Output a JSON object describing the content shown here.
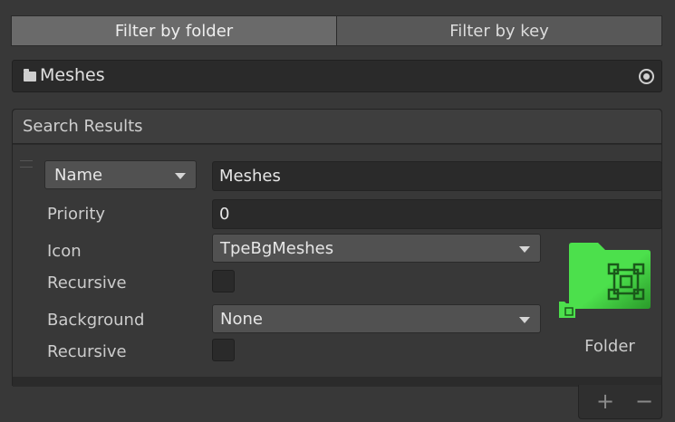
{
  "tabs": [
    {
      "label": "Filter by folder",
      "active": true
    },
    {
      "label": "Filter by key",
      "active": false
    }
  ],
  "folder_field": {
    "icon": "folder-icon",
    "value": "Meshes",
    "picker_icon": "target-icon"
  },
  "results": {
    "title": "Search Results",
    "rule": {
      "filter_type": "Name",
      "filter_value": "Meshes",
      "priority_label": "Priority",
      "priority_value": "0",
      "icon_label": "Icon",
      "icon_value": "TpeBgMeshes",
      "icon_recursive_label": "Recursive",
      "icon_recursive": false,
      "background_label": "Background",
      "background_value": "None",
      "background_recursive_label": "Recursive",
      "background_recursive": false,
      "preview_label": "Folder",
      "preview_color": "#4ce04c"
    }
  },
  "footer": {
    "add_label": "+",
    "remove_label": "−"
  }
}
